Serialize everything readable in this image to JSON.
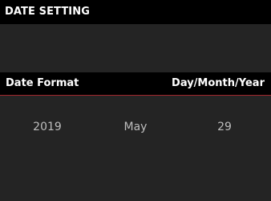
{
  "screen": {
    "title": "DATE SETTING"
  },
  "setting": {
    "label": "Date Format",
    "value": "Day/Month/Year"
  },
  "date": {
    "year": "2019",
    "month": "May",
    "day": "29"
  },
  "colors": {
    "background": "#242424",
    "bar": "#000000",
    "accent_line": "#a3262b",
    "text": "#ffffff",
    "dim_text": "#bdbdbd"
  }
}
